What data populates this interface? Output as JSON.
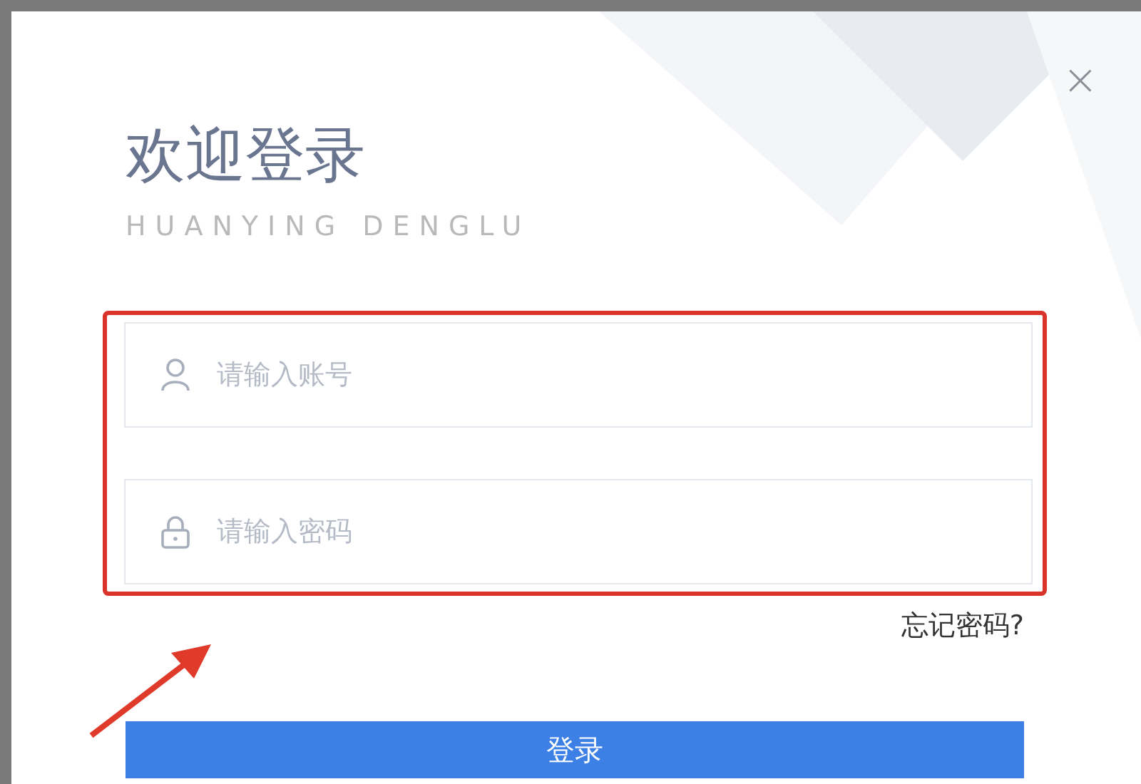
{
  "dialog": {
    "title": "欢迎登录",
    "subtitle": "HUANYING DENGLU",
    "close": "×"
  },
  "fields": [
    {
      "kind": "user",
      "placeholder": "请输入账号"
    },
    {
      "kind": "password",
      "placeholder": "请输入密码"
    }
  ],
  "forgot_link": "忘记密码?",
  "submit_button": "登录"
}
